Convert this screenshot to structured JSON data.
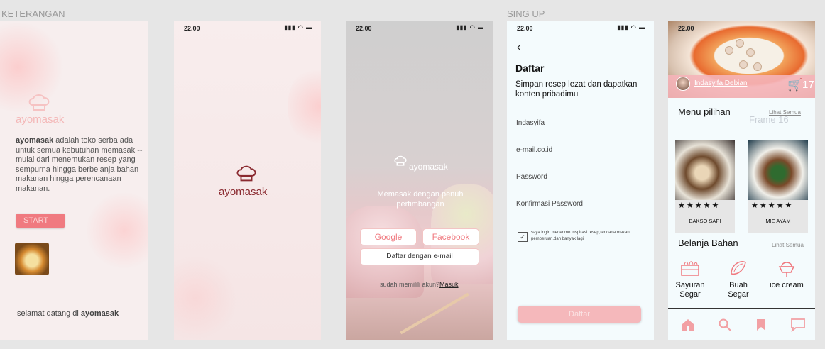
{
  "labels": {
    "keterangan": "KETERANGAN",
    "signup": "SING UP"
  },
  "status": {
    "time": "22.00",
    "icons": "▮▮▮ ◠ ▬"
  },
  "frame1": {
    "brand": "ayomasak",
    "desc_bold": "ayomasak",
    "desc_rest": " adalah  toko serba ada untuk semua kebutuhan memasak  --mulai dari menemukan resep yang sempurna hingga berbelanja bahan makanan hingga perencanaan makanan.",
    "start": "START",
    "welcome_prefix": "selamat datang di ",
    "welcome_brand": "ayomasak"
  },
  "frame2": {
    "brand": "ayomasak"
  },
  "frame3": {
    "brand": "ayomasak",
    "tagline": "Memasak dengan penuh pertimbangan",
    "google": "Google",
    "facebook": "Facebook",
    "email": "Daftar dengan e-mail",
    "have_account": "sudah memilili akun?",
    "login": "Masuk"
  },
  "frame4": {
    "back": "‹",
    "title": "Daftar",
    "subtitle": "Simpan resep lezat dan dapatkan konten pribadimu",
    "fields": {
      "name": "Indasyifa",
      "email": "e-mail.co.id",
      "password": "Password",
      "confirm": "Konfirmasi Password"
    },
    "check_mark": "✓",
    "check_text": "saya ingin menerimo inspirasi resep,rencana makan pemberuan,dan banyak lagi",
    "submit": "Daftar"
  },
  "frame5": {
    "username": "Indasyifa Debian",
    "cart_icon": "🛒",
    "cart_count": "17",
    "menu_title": "Menu pilihan",
    "see_all": "Lihat Semua",
    "frame_label": "Frame 16",
    "stars": "★★★★★",
    "cards": [
      "BAKSO SAPI",
      "MIE AYAM"
    ],
    "belanja": "Belanja Bahan",
    "see_all2": "Lihat Semua",
    "categories": [
      {
        "label": "Sayuran Segar",
        "icon": "vegetable-crate-icon"
      },
      {
        "label": "Buah Segar",
        "icon": "fruit-icon"
      },
      {
        "label": "ice cream",
        "icon": "ice-cream-icon"
      }
    ]
  },
  "colors": {
    "accent": "#f07a80",
    "brand_dark": "#8a2a30",
    "pink_light": "#f5b8bb"
  }
}
